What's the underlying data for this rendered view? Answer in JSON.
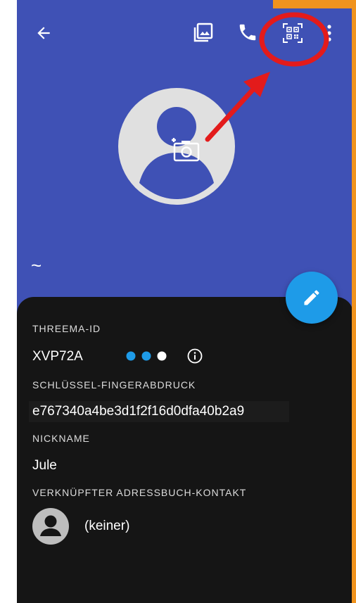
{
  "header": {
    "name_display": "~",
    "icons": {
      "back": "arrow-back-icon",
      "gallery": "image-gallery-icon",
      "call": "phone-icon",
      "qr": "qr-code-icon",
      "more": "more-vertical-icon",
      "avatar": "default-avatar-icon",
      "camera": "add-photo-icon"
    }
  },
  "profile": {
    "threema_id_label": "THREEMA-ID",
    "threema_id": "XVP72A",
    "verification_dots": [
      "#1e9be8",
      "#1e9be8",
      "#ffffff"
    ],
    "fingerprint_label": "SCHLÜSSEL-FINGERABDRUCK",
    "fingerprint": "e767340a4be3d1f2f16d0dfa40b2a9",
    "nickname_label": "NICKNAME",
    "nickname": "Jule",
    "linked_contact_label": "VERKNÜPFTER ADRESSBUCH-KONTAKT",
    "linked_contact": "(keiner)"
  },
  "colors": {
    "header": "#3f51b5",
    "fab": "#1e9be8",
    "annotation": "#e31b1b",
    "frame": "#f0931e"
  }
}
